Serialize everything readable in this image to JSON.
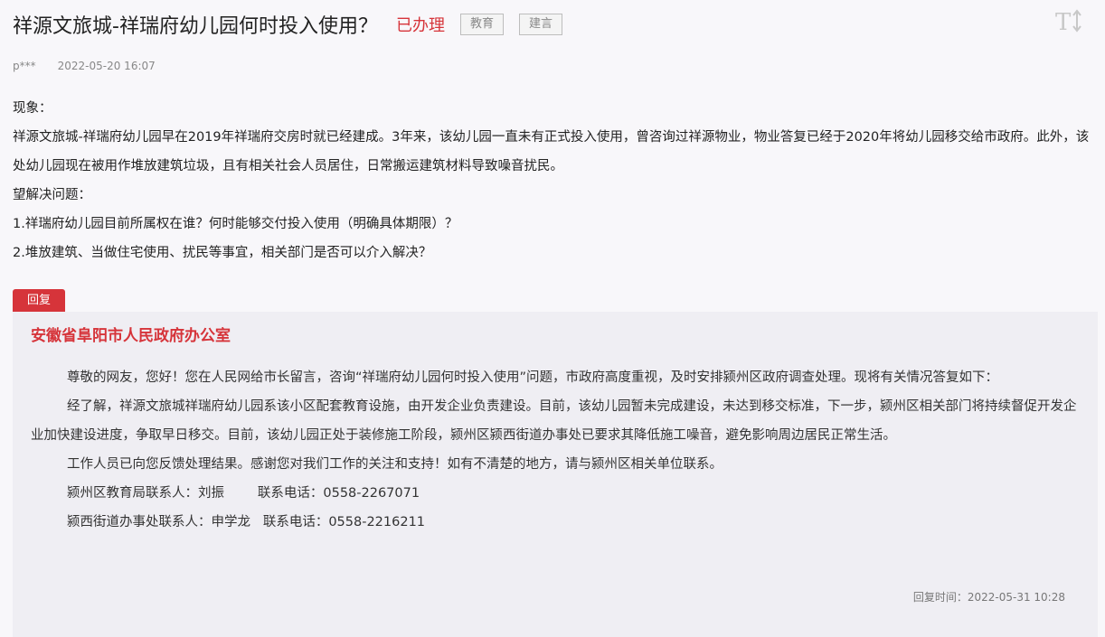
{
  "header": {
    "title": "祥源文旅城-祥瑞府幼儿园何时投入使用？",
    "status": "已办理",
    "tags": [
      "教育",
      "建言"
    ],
    "font_toggle_icon": "font-size-toggle-icon"
  },
  "meta": {
    "author": "p***",
    "date": "2022-05-20 16:07"
  },
  "question": {
    "lines": [
      "现象：",
      "祥源文旅城-祥瑞府幼儿园早在2019年祥瑞府交房时就已经建成。3年来，该幼儿园一直未有正式投入使用，曾咨询过祥源物业，物业答复已经于2020年将幼儿园移交给市政府。此外，该处幼儿园现在被用作堆放建筑垃圾，且有相关社会人员居住，日常搬运建筑材料导致噪音扰民。",
      "望解决问题：",
      "1.祥瑞府幼儿园目前所属权在谁？何时能够交付投入使用（明确具体期限）？",
      "2.堆放建筑、当做住宅使用、扰民等事宜，相关部门是否可以介入解决？"
    ]
  },
  "reply": {
    "tab_label": "回复",
    "org": "安徽省阜阳市人民政府办公室",
    "paragraphs": [
      "尊敬的网友，您好！您在人民网给市长留言，咨询“祥瑞府幼儿园何时投入使用”问题，市政府高度重视，及时安排颍州区政府调查处理。现将有关情况答复如下：",
      "经了解，祥源文旅城祥瑞府幼儿园系该小区配套教育设施，由开发企业负责建设。目前，该幼儿园暂未完成建设，未达到移交标准，下一步，颍州区相关部门将持续督促开发企业加快建设进度，争取早日移交。目前，该幼儿园正处于装修施工阶段，颍州区颍西街道办事处已要求其降低施工噪音，避免影响周边居民正常生活。",
      " 工作人员已向您反馈处理结果。感谢您对我们工作的关注和支持！如有不清楚的地方，请与颍州区相关单位联系。"
    ],
    "contacts": [
      "颍州区教育局联系人：刘振        联系电话：0558-2267071",
      "颍西街道办事处联系人：申学龙   联系电话：0558-2216211"
    ],
    "reply_time": "回复时间：2022-05-31 10:28"
  }
}
